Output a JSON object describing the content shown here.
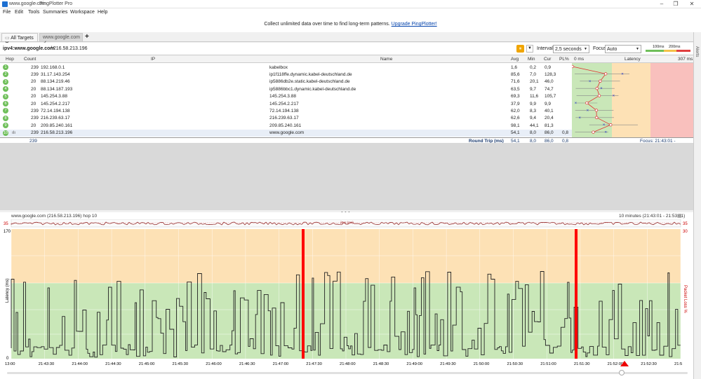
{
  "window": {
    "url": "www.google.com",
    "app": "PingPlotter Pro"
  },
  "menu": [
    "File",
    "Edit",
    "Tools",
    "Summaries",
    "Workspace",
    "Help"
  ],
  "banner": {
    "text": "Collect unlimited data over time to find long-term patterns.",
    "link": "Upgrade PingPlotter!"
  },
  "tabs": {
    "all": "All Targets",
    "current": "www.google.com",
    "add": "+"
  },
  "target": {
    "name": "ipv4:www.google.com",
    "ip": "/ 216.58.213.196",
    "interval_label": "Interval",
    "interval_value": "2,5 seconds",
    "focus_label": "Focus",
    "focus_value": "Auto",
    "scale_a": "100ms",
    "scale_b": "200ms"
  },
  "alerts_label": "Alerts",
  "table": {
    "headers": {
      "hop": "Hop",
      "count": "Count",
      "ip": "IP",
      "name": "Name",
      "avg": "Avg",
      "min": "Min",
      "cur": "Cur",
      "pl": "PL%",
      "ms0": "0 ms",
      "latency": "Latency",
      "msmax": "307 ms"
    },
    "rows": [
      {
        "hop": "1",
        "count": "239",
        "ip": "192.168.0.1",
        "name": "kabelbox",
        "avg": "1,6",
        "min": "0,2",
        "cur": "0,9",
        "pl": ""
      },
      {
        "hop": "2",
        "count": "239",
        "ip": "31.17.143.254",
        "name": "ip1f118ffe.dynamic.kabel-deutschland.de",
        "avg": "85,6",
        "min": "7,0",
        "cur": "128,3",
        "pl": ""
      },
      {
        "hop": "3",
        "count": "20",
        "ip": "88.134.219.46",
        "name": "ip5886db2e.static.kabel-deutschland.de",
        "avg": "71,6",
        "min": "20,1",
        "cur": "46,0",
        "pl": ""
      },
      {
        "hop": "4",
        "count": "20",
        "ip": "88.134.187.193",
        "name": "ip5886bbc1.dynamic.kabel-deutschland.de",
        "avg": "63,5",
        "min": "9,7",
        "cur": "74,7",
        "pl": ""
      },
      {
        "hop": "5",
        "count": "20",
        "ip": "145.254.3.88",
        "name": "145.254.3.88",
        "avg": "69,3",
        "min": "11,6",
        "cur": "105,7",
        "pl": ""
      },
      {
        "hop": "6",
        "count": "20",
        "ip": "145.254.2.217",
        "name": "145.254.2.217",
        "avg": "37,9",
        "min": "9,9",
        "cur": "9,9",
        "pl": ""
      },
      {
        "hop": "7",
        "count": "239",
        "ip": "72.14.194.138",
        "name": "72.14.194.138",
        "avg": "62,0",
        "min": "8,3",
        "cur": "40,1",
        "pl": ""
      },
      {
        "hop": "8",
        "count": "239",
        "ip": "216.239.63.17",
        "name": "216.239.63.17",
        "avg": "62,6",
        "min": "9,4",
        "cur": "20,4",
        "pl": ""
      },
      {
        "hop": "9",
        "count": "20",
        "ip": "209.85.240.161",
        "name": "209.85.240.161",
        "avg": "98,1",
        "min": "44,1",
        "cur": "81,3",
        "pl": ""
      },
      {
        "hop": "10",
        "count": "239",
        "ip": "216.58.213.196",
        "name": "www.google.com",
        "avg": "54,1",
        "min": "8,0",
        "cur": "86,0",
        "pl": "0,8"
      }
    ],
    "summary": {
      "count": "239",
      "label": "Round Trip (ms)",
      "avg": "54,1",
      "min": "8,0",
      "cur": "86,0",
      "pl": "0,8",
      "focus": "Focus: 21:43:01 - 21:53:01"
    }
  },
  "timeline": {
    "title": "www.google.com (216.58.213.196) hop 10",
    "range": "10 minutes (21:43:01 - 21:53:01)",
    "jitter_label": "jitter (ms)",
    "jitter_max": "35",
    "pl_max": "30",
    "y_max": "170",
    "y_zero": "0",
    "y_label": "Latency (ms)",
    "pl_label": "Packet Loss %",
    "x_ticks": [
      "13:00",
      "21:43:30",
      "21:44:00",
      "21:44:30",
      "21:45:00",
      "21:45:30",
      "21:46:00",
      "21:46:30",
      "21:47:00",
      "21:47:30",
      "21:48:00",
      "21:48:30",
      "21:49:00",
      "21:49:30",
      "21:50:00",
      "21:50:30",
      "21:51:00",
      "21:51:30",
      "21:52:00",
      "21:52:30",
      "21:5"
    ]
  },
  "colors": {
    "good": "#c9e7b8",
    "warn": "#fde1b5",
    "bad": "#f9c0bd",
    "line": "#222222",
    "loss": "#ff0000"
  }
}
